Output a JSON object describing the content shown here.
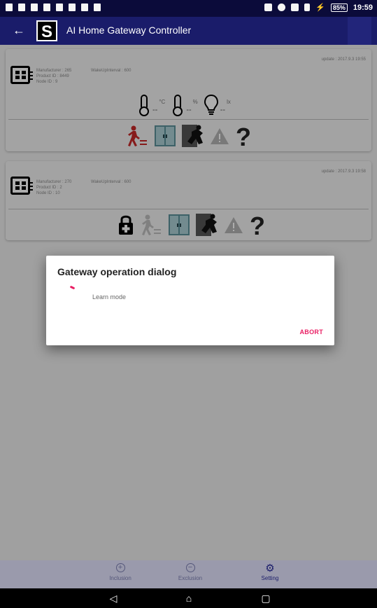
{
  "status_bar": {
    "left_icons": [
      "photo-icon",
      "warning-icon",
      "cloud-icon",
      "usb-icon",
      "sd-card-icon",
      "image-icon",
      "music-icon",
      "bug-icon"
    ],
    "right_icons": [
      "nfc-icon",
      "dnd-icon",
      "wifi-icon",
      "sim-icon",
      "charging-icon"
    ],
    "battery": "85%",
    "time": "19:59"
  },
  "app_bar": {
    "back_icon": "arrow-left-icon",
    "logo_text": "S",
    "title": "AI Home Gateway Controller"
  },
  "devices": [
    {
      "update": "update : 2017.9.3 19:55",
      "manufacturer": "Manufacturer : 265",
      "product_id": "Product ID : 8449",
      "node_id": "Node ID : 9",
      "wakeup": "WakeUpInterval : 600",
      "sensors": [
        {
          "icon": "thermometer-icon",
          "value": "--",
          "unit": "°C"
        },
        {
          "icon": "thermometer-icon",
          "value": "--",
          "unit": "%"
        },
        {
          "icon": "lightbulb-icon",
          "value": "--",
          "unit": "lx"
        }
      ],
      "state_icons": [
        "motion-active-icon",
        "door-window-icon",
        "intrusion-icon",
        "warning-icon",
        "question-icon"
      ]
    },
    {
      "update": "update : 2017.9.3 19:58",
      "manufacturer": "Manufacturer : 270",
      "product_id": "Product ID : 2",
      "node_id": "Node ID : 10",
      "wakeup": "WakeUpInterval : 600",
      "state_icons": [
        "lock-icon",
        "motion-inactive-icon",
        "door-window-icon",
        "intrusion-icon",
        "warning-icon",
        "question-icon"
      ]
    }
  ],
  "dialog": {
    "title": "Gateway operation dialog",
    "message": "Learn mode",
    "abort_label": "ABORT",
    "accent_color": "#e91e63"
  },
  "bottom_nav": {
    "items": [
      {
        "label": "Inclusion",
        "icon": "plus-circle-icon",
        "active": false
      },
      {
        "label": "Exclusion",
        "icon": "minus-circle-icon",
        "active": false
      },
      {
        "label": "Setting",
        "icon": "gear-icon",
        "active": true
      }
    ]
  },
  "system_nav": [
    "back-triangle-icon",
    "home-icon",
    "recents-icon"
  ],
  "colors": {
    "app_bar": "#1a1c6a",
    "status_bar": "#0b0b3a",
    "accent": "#e91e63"
  }
}
